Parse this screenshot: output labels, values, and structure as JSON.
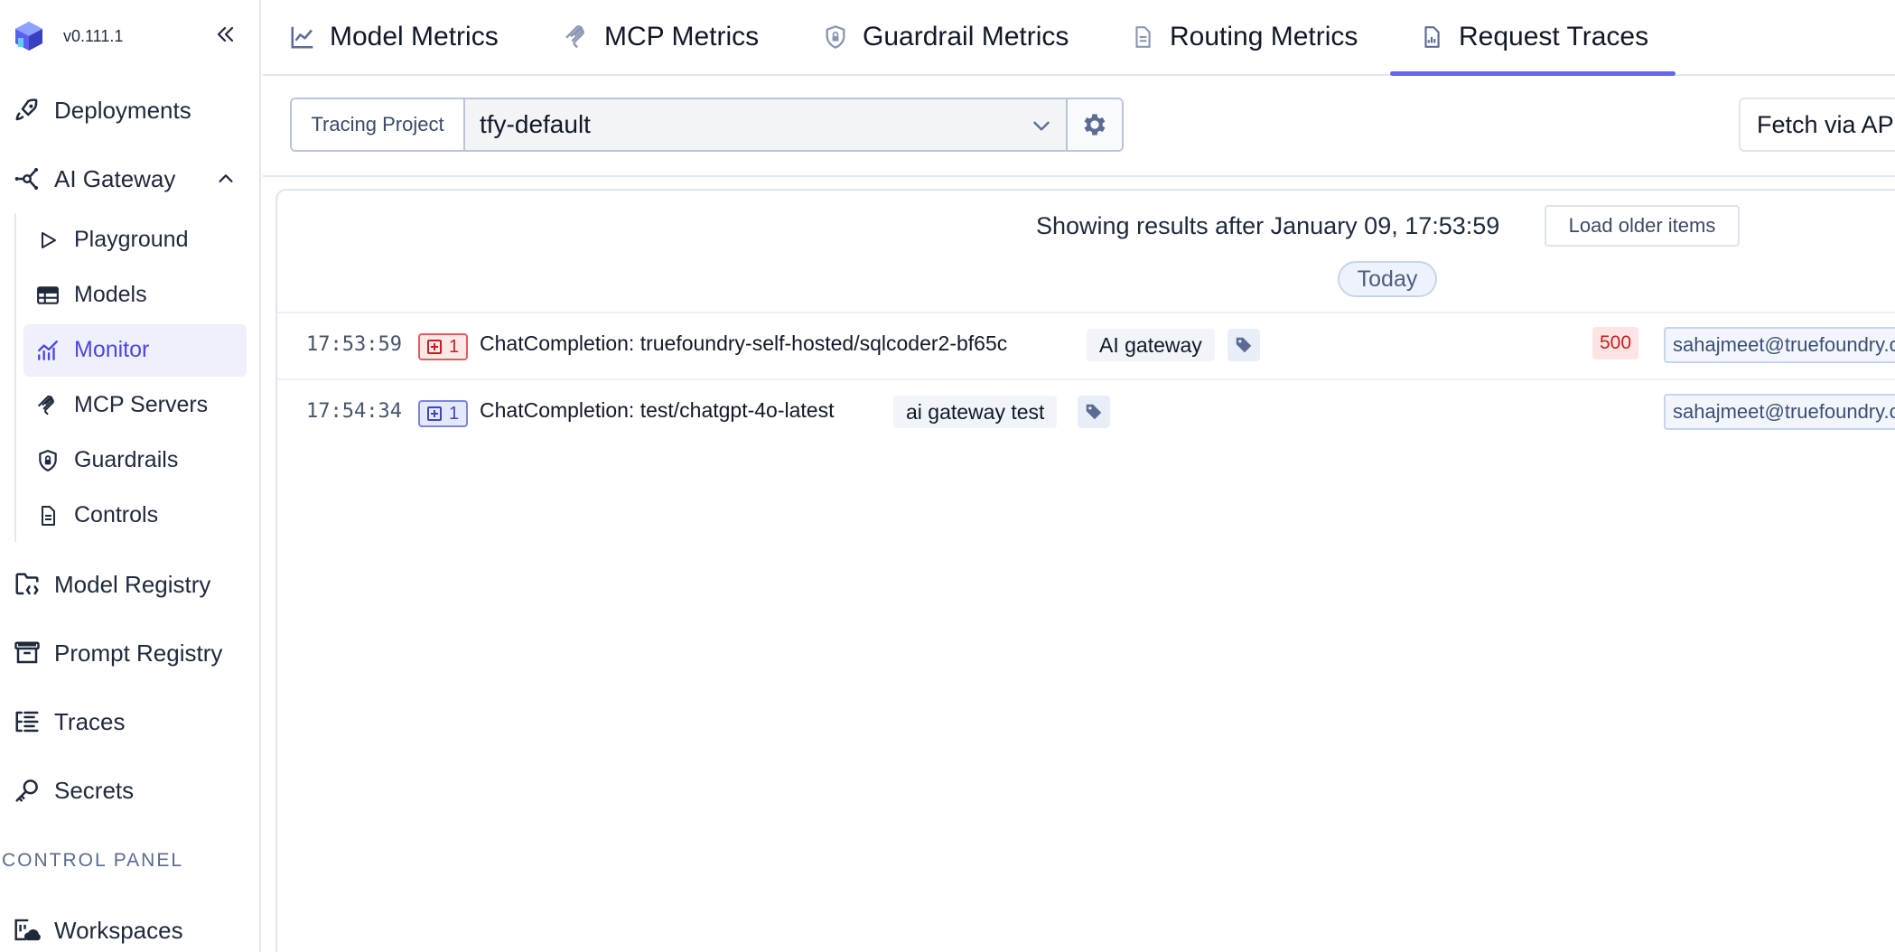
{
  "app": {
    "version": "v0.111.1"
  },
  "sidebar": {
    "top_items": [
      {
        "label": "Deployments",
        "icon": "rocket-icon"
      },
      {
        "label": "AI Gateway",
        "icon": "gateway-icon"
      }
    ],
    "gateway_items": [
      {
        "label": "Playground",
        "icon": "play-icon"
      },
      {
        "label": "Models",
        "icon": "table-icon"
      },
      {
        "label": "Monitor",
        "icon": "chart-icon",
        "active": true
      },
      {
        "label": "MCP Servers",
        "icon": "mcp-icon"
      },
      {
        "label": "Guardrails",
        "icon": "shield-icon"
      },
      {
        "label": "Controls",
        "icon": "document-icon"
      }
    ],
    "bottom_items": [
      {
        "label": "Model Registry",
        "icon": "folder-code-icon"
      },
      {
        "label": "Prompt Registry",
        "icon": "archive-icon"
      },
      {
        "label": "Traces",
        "icon": "list-tree-icon"
      },
      {
        "label": "Secrets",
        "icon": "key-icon"
      }
    ],
    "section_label": "CONTROL PANEL",
    "control_items": [
      {
        "label": "Workspaces",
        "icon": "workspace-icon"
      }
    ]
  },
  "tabs": [
    {
      "label": "Model Metrics",
      "icon": "line-chart-icon"
    },
    {
      "label": "MCP Metrics",
      "icon": "mcp-icon"
    },
    {
      "label": "Guardrail Metrics",
      "icon": "shield-icon"
    },
    {
      "label": "Routing Metrics",
      "icon": "document-icon"
    },
    {
      "label": "Request Traces",
      "icon": "report-icon",
      "active": true
    }
  ],
  "toolbar": {
    "project_label": "Tracing Project",
    "project_value": "tfy-default",
    "fetch_label": "Fetch via API"
  },
  "results": {
    "showing_text": "Showing results after January 09, 17:53:59",
    "load_older_label": "Load older items",
    "day_label": "Today",
    "rows": [
      {
        "time": "17:53:59",
        "count": "1",
        "count_style": "error",
        "title": "ChatCompletion: truefoundry-self-hosted/sqlcoder2-bf65c",
        "tag": "AI gateway",
        "status": "500",
        "user": "sahajmeet@truefoundry.com"
      },
      {
        "time": "17:54:34",
        "count": "1",
        "count_style": "ok",
        "title": "ChatCompletion: test/chatgpt-4o-latest",
        "tag": "ai gateway test",
        "status": "",
        "user": "sahajmeet@truefoundry.com"
      }
    ]
  },
  "colors": {
    "accent": "#6366f1",
    "active_bg": "#eef0fb",
    "error": "#c81e1e",
    "icon_blue": "#5b6b95"
  }
}
